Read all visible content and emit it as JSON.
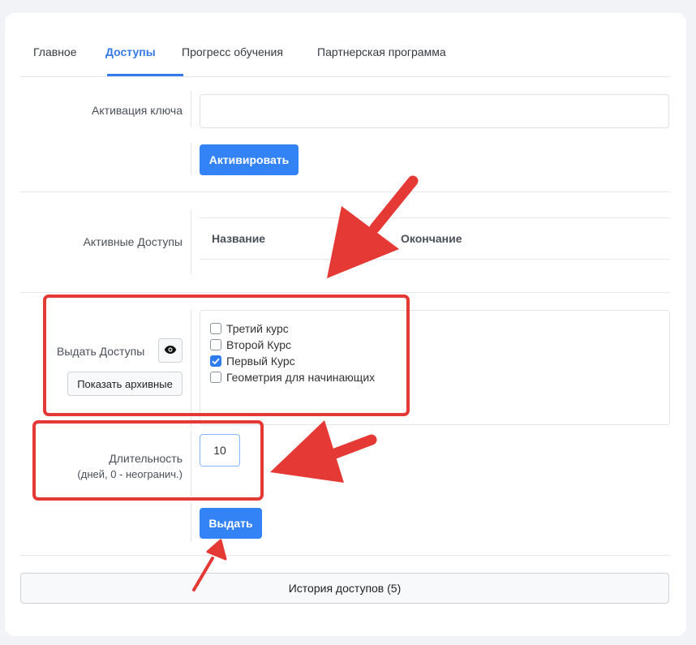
{
  "tabs": [
    {
      "label": "Главное",
      "active": false
    },
    {
      "label": "Доступы",
      "active": true
    },
    {
      "label": "Прогресс обучения",
      "active": false
    },
    {
      "label": "Партнерская программа",
      "active": false
    }
  ],
  "activation": {
    "label": "Активация ключа",
    "key_value": "",
    "button_label": "Активировать"
  },
  "active_access": {
    "label": "Активные Доступы",
    "columns": [
      "Название",
      "Окончание"
    ]
  },
  "grant": {
    "label": "Выдать Доступы",
    "show_archived_label": "Показать архивные",
    "courses": [
      {
        "label": "Третий курс",
        "checked": false
      },
      {
        "label": "Второй Курс",
        "checked": false
      },
      {
        "label": "Первый Курс",
        "checked": true
      },
      {
        "label": "Геометрия для начинающих",
        "checked": false
      }
    ],
    "duration_label": "Длительность",
    "duration_hint": "(дней, 0 - неогранич.)",
    "duration_value": "10",
    "submit_label": "Выдать"
  },
  "history": {
    "button_label": "История доступов (5)"
  },
  "colors": {
    "accent": "#3579e8",
    "primary_button": "#3383f6",
    "annotation_red": "#e53935"
  },
  "icons": {
    "toggle_visibility": "eye-icon",
    "checkbox_checked": "check-icon"
  }
}
